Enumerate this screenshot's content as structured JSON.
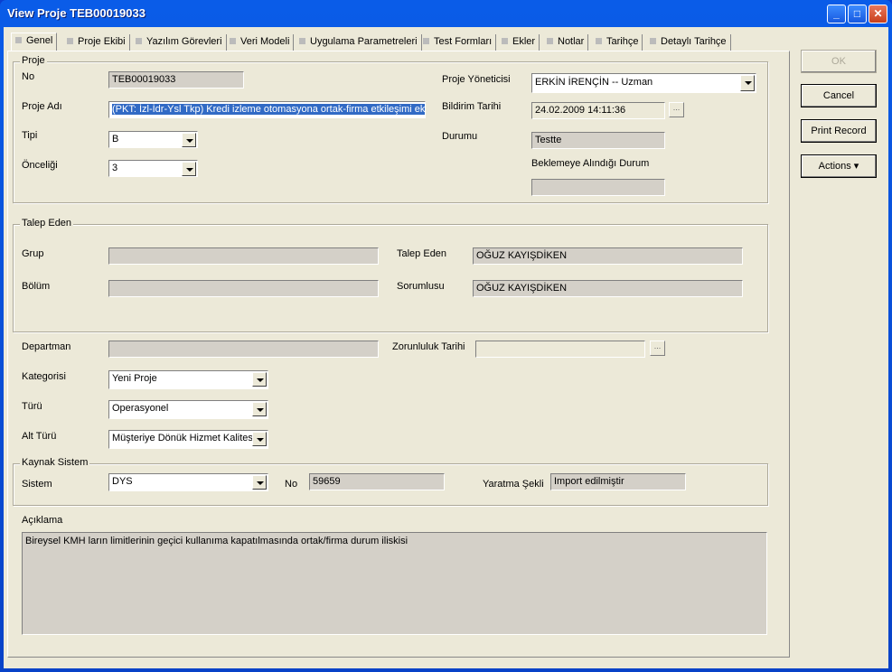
{
  "window": {
    "title": "View Proje TEB00019033",
    "minimize": "_",
    "maximize": "□",
    "close": "✕"
  },
  "tabs": [
    {
      "label": "Genel"
    },
    {
      "label": "Proje Ekibi"
    },
    {
      "label": "Yazılım Görevleri"
    },
    {
      "label": "Veri Modeli"
    },
    {
      "label": "Uygulama Parametreleri"
    },
    {
      "label": "Test Formları"
    },
    {
      "label": "Ekler"
    },
    {
      "label": "Notlar"
    },
    {
      "label": "Tarihçe"
    },
    {
      "label": "Detaylı Tarihçe"
    }
  ],
  "proje": {
    "legend": "Proje",
    "no_label": "No",
    "no": "TEB00019033",
    "adi_label": "Proje Adı",
    "adi": "(PKT: İzl-İdr-Ysl Tkp) Kredi izleme otomasyona ortak-firma etkileşimi eklenm",
    "tipi_label": "Tipi",
    "tipi": "B",
    "onceligi_label": "Önceliği",
    "onceligi": "3",
    "yonetici_label": "Proje Yöneticisi",
    "yonetici": "ERKİN İRENÇİN -- Uzman",
    "bildirim_label": "Bildirim Tarihi",
    "bildirim": "24.02.2009 14:11:36",
    "durumu_label": "Durumu",
    "durumu": "Testte",
    "beklemeye_label": "Beklemeye Alındığı Durum",
    "beklemeye": "",
    "browse": "..."
  },
  "talep": {
    "legend": "Talep Eden",
    "grup_label": "Grup",
    "grup": "",
    "bolum_label": "Bölüm",
    "bolum": "",
    "talep_eden_label": "Talep Eden",
    "talep_eden": "OĞUZ KAYIŞDİKEN",
    "sorumlusu_label": "Sorumlusu",
    "sorumlusu": "OĞUZ KAYIŞDİKEN"
  },
  "main": {
    "departman_label": "Departman",
    "departman": "",
    "zorunluluk_label": "Zorunluluk Tarihi",
    "zorunluluk": "",
    "kategori_label": "Kategorisi",
    "kategori": "Yeni Proje",
    "turu_label": "Türü",
    "turu": "Operasyonel",
    "alt_turu_label": "Alt Türü",
    "alt_turu": "Müşteriye Dönük Hizmet Kalitesi"
  },
  "kaynak": {
    "legend": "Kaynak Sistem",
    "sistem_label": "Sistem",
    "sistem": "DYS",
    "no_label": "No",
    "no": "59659",
    "yaratma_label": "Yaratma Şekli",
    "yaratma": "Import edilmiştir"
  },
  "aciklama": {
    "label": "Açıklama",
    "text": "Bireysel KMH ların limitlerinin geçici kullanıma kapatılmasında ortak/firma durum iliskisi"
  },
  "buttons": {
    "ok": "OK",
    "cancel": "Cancel",
    "print": "Print Record",
    "actions": "Actions ▾"
  }
}
